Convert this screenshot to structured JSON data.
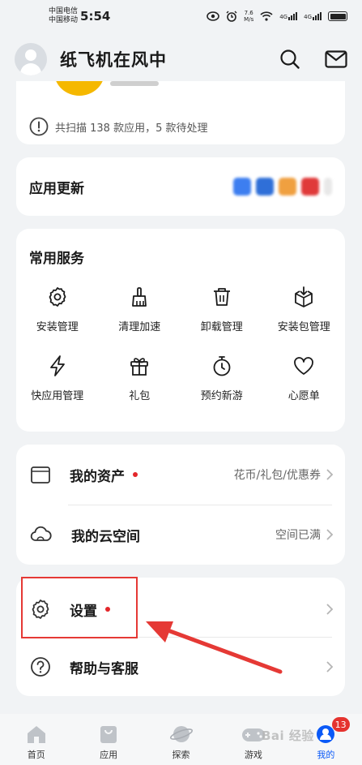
{
  "status_bar": {
    "carrier_1": "中国电信",
    "carrier_2": "中国移动",
    "time": "5:54",
    "net_speed_value": "7.6",
    "net_speed_unit": "M/s",
    "sig1_label": "4G",
    "sig2_label": "4G"
  },
  "header": {
    "username": "纸飞机在风中"
  },
  "scan": {
    "text": "共扫描 138 款应用，5 款待处理"
  },
  "app_update": {
    "title": "应用更新",
    "icon_colors": [
      "#3d7ef0",
      "#2f6fd8",
      "#f0a040",
      "#e03a3a"
    ]
  },
  "services": {
    "title": "常用服务",
    "items": [
      {
        "label": "安装管理",
        "icon": "gear-icon"
      },
      {
        "label": "清理加速",
        "icon": "broom-icon"
      },
      {
        "label": "卸载管理",
        "icon": "trash-icon"
      },
      {
        "label": "安装包管理",
        "icon": "package-download-icon"
      },
      {
        "label": "快应用管理",
        "icon": "lightning-icon"
      },
      {
        "label": "礼包",
        "icon": "gift-icon"
      },
      {
        "label": "预约新游",
        "icon": "stopwatch-icon"
      },
      {
        "label": "心愿单",
        "icon": "heart-icon"
      }
    ]
  },
  "assets": {
    "my_assets_label": "我的资产",
    "my_assets_detail": "花币/礼包/优惠券",
    "cloud_label": "我的云空间",
    "cloud_detail": "空间已满"
  },
  "settings": {
    "settings_label": "设置",
    "help_label": "帮助与客服"
  },
  "tabbar": {
    "tabs": [
      {
        "label": "首页",
        "icon": "home-icon"
      },
      {
        "label": "应用",
        "icon": "bag-icon"
      },
      {
        "label": "探索",
        "icon": "planet-icon"
      },
      {
        "label": "游戏",
        "icon": "gamepad-icon"
      },
      {
        "label": "我的",
        "icon": "profile-icon"
      }
    ],
    "badge_count": "13",
    "watermark": "Bai 经验"
  },
  "colors": {
    "accent": "#0a59f7",
    "alert_red": "#e3262a",
    "highlight_frame": "#e53935"
  }
}
